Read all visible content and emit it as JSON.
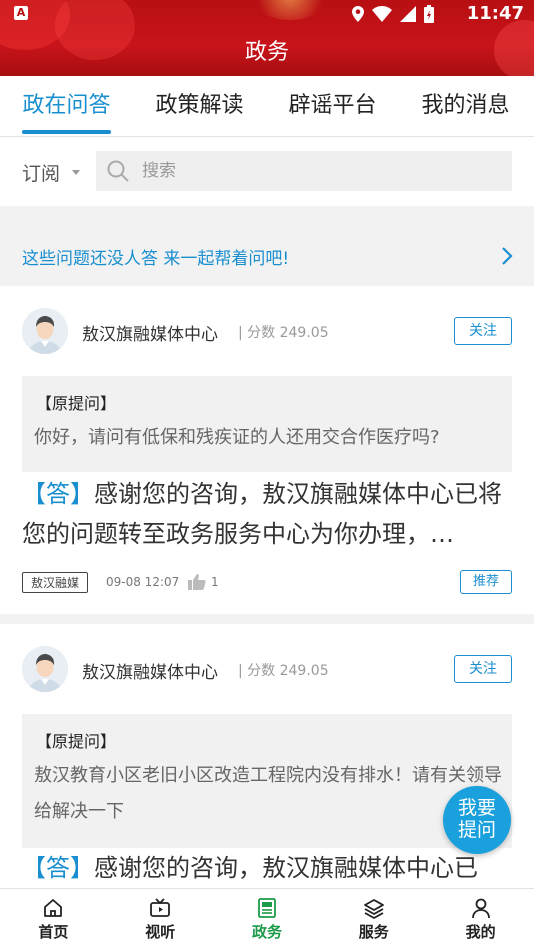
{
  "status": {
    "time": "11:47",
    "app_badge": "A"
  },
  "header": {
    "title": "政务"
  },
  "tabs": [
    {
      "label": "政在问答",
      "active": true
    },
    {
      "label": "政策解读",
      "active": false
    },
    {
      "label": "辟谣平台",
      "active": false
    },
    {
      "label": "我的消息",
      "active": false
    }
  ],
  "search": {
    "subscribe_label": "订阅",
    "placeholder": "搜索"
  },
  "prompt": {
    "text": "这些问题还没人答 来一起帮着问吧!"
  },
  "posts": [
    {
      "author": "敖汉旗融媒体中心",
      "score": "| 分数 249.05",
      "follow_label": "关注",
      "question_label": "【原提问】",
      "question": "你好，请问有低保和残疾证的人还用交合作医疗吗?",
      "answer_tag": "【答】",
      "answer": "感谢您的咨询，敖汉旗融媒体中心已将您的问题转至政务服务中心为你办理，…",
      "source": "敖汉融媒",
      "time": "09-08 12:07",
      "likes": "1",
      "recommend_label": "推荐"
    },
    {
      "author": "敖汉旗融媒体中心",
      "score": "| 分数 249.05",
      "follow_label": "关注",
      "question_label": "【原提问】",
      "question": "敖汉教育小区老旧小区改造工程院内没有排水！请有关领导给解决一下",
      "answer_tag": "【答】",
      "answer": "感谢您的咨询，敖汉旗融媒体中心已"
    }
  ],
  "fab": {
    "line1": "我要",
    "line2": "提问"
  },
  "bottom_nav": [
    {
      "label": "首页",
      "icon": "home-icon"
    },
    {
      "label": "视听",
      "icon": "tv-icon"
    },
    {
      "label": "政务",
      "icon": "news-icon",
      "active": true
    },
    {
      "label": "服务",
      "icon": "layers-icon"
    },
    {
      "label": "我的",
      "icon": "person-icon"
    }
  ],
  "colors": {
    "accent": "#1a8fd0",
    "header_red": "#c8141a",
    "nav_active": "#1b9a4a"
  }
}
